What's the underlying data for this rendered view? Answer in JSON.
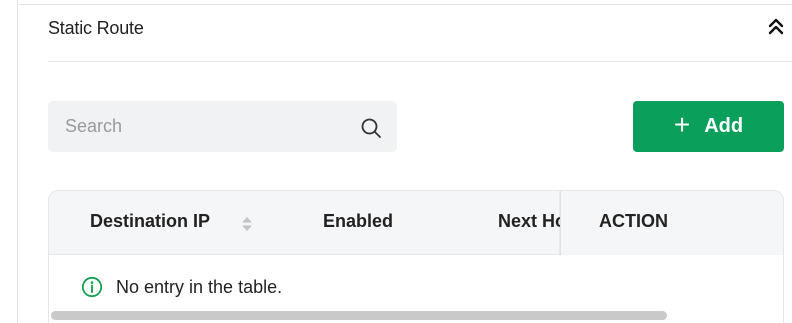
{
  "section": {
    "title": "Static Route",
    "collapse_icon": "double-chevron-up-icon"
  },
  "search": {
    "placeholder": "Search",
    "value": "",
    "icon": "search-icon"
  },
  "toolbar": {
    "add_label": "Add",
    "add_icon": "+"
  },
  "table": {
    "columns": [
      {
        "label": "Destination IP",
        "sortable": true
      },
      {
        "label": "Enabled",
        "sortable": false
      },
      {
        "label": "Next Hop",
        "sortable": false
      },
      {
        "label": "ACTION",
        "sortable": false
      }
    ],
    "empty_message": "No entry in the table.",
    "empty_icon": "info-circle-icon"
  },
  "colors": {
    "accent": "#0aa05c",
    "info_icon": "#12a14f"
  }
}
